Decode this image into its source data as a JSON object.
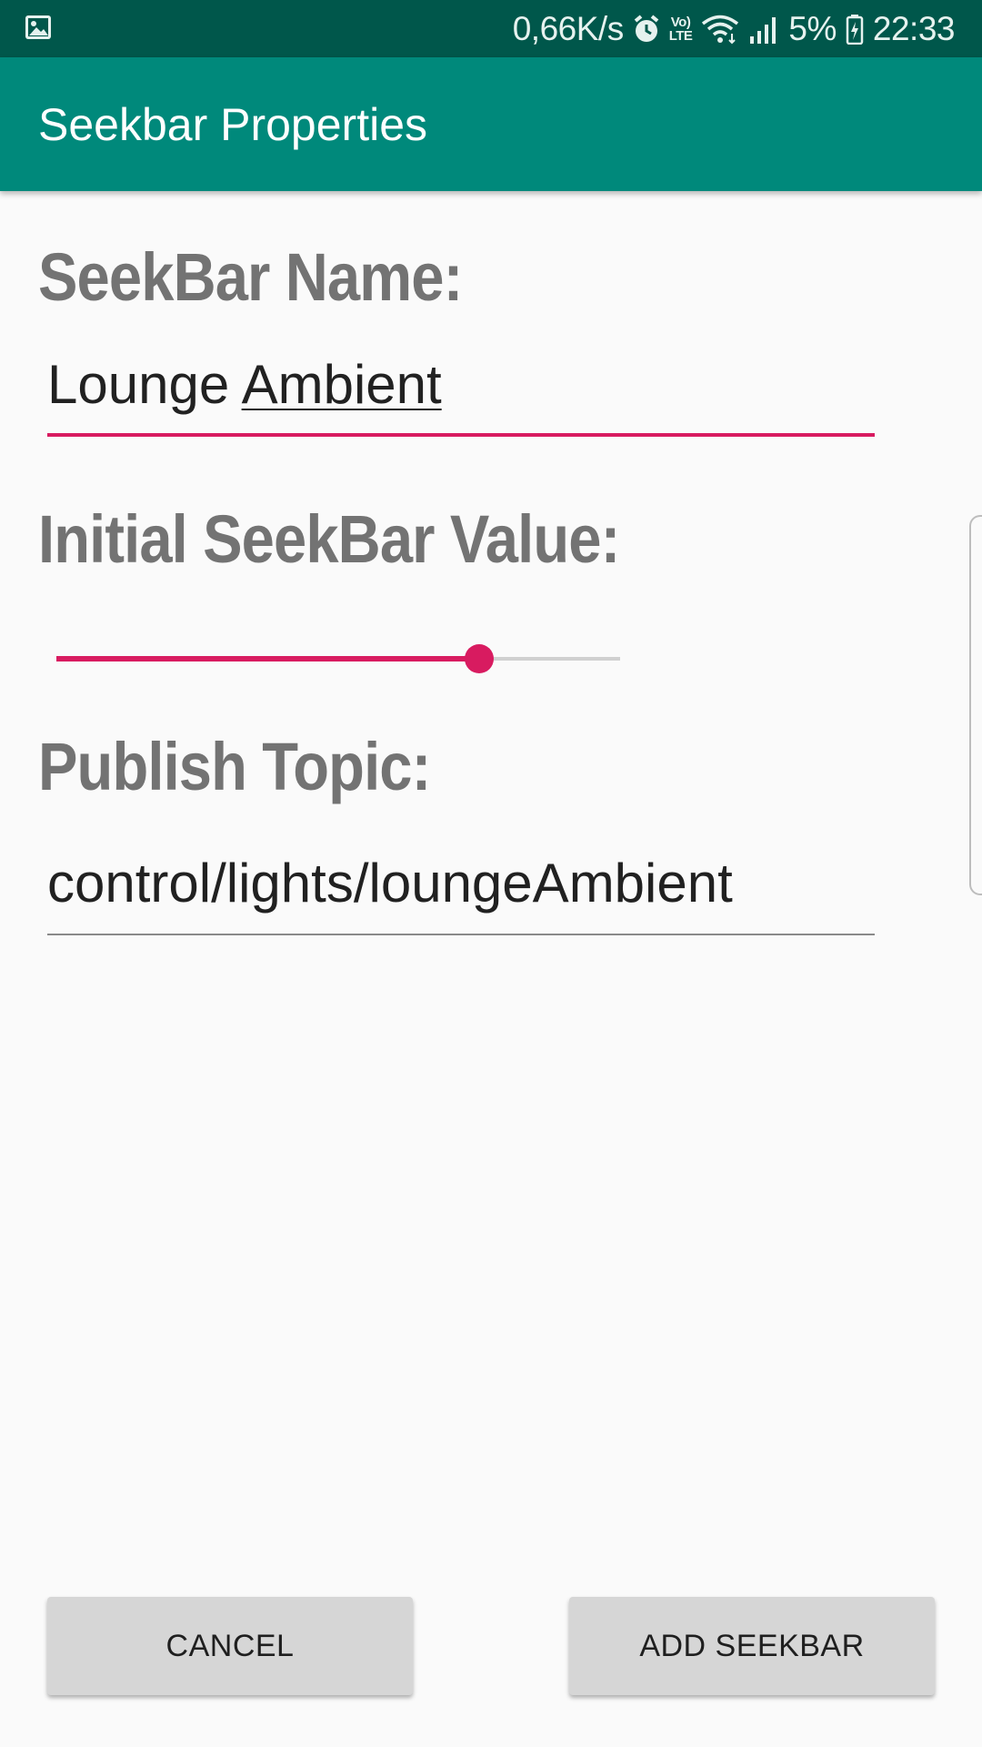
{
  "status_bar": {
    "net_speed": "0,66K/s",
    "volte_top": "Vo)",
    "volte_bottom": "LTE",
    "battery": "5%",
    "time": "22:33",
    "icons": [
      "image-notification-icon",
      "alarm-icon",
      "volte-icon",
      "wifi-icon",
      "signal-icon",
      "battery-icon"
    ]
  },
  "app_bar": {
    "title": "Seekbar Properties"
  },
  "form": {
    "name_label": "SeekBar Name:",
    "name_value_part1": "Lounge ",
    "name_value_part2": "Ambient",
    "initial_value_label": "Initial SeekBar Value:",
    "seekbar_fraction": 0.75,
    "topic_label": "Publish Topic:",
    "topic_value": "control/lights/loungeAmbient"
  },
  "buttons": {
    "cancel_label": "CANCEL",
    "add_label": "ADD SEEKBAR"
  },
  "colors": {
    "status_bar": "#00574b",
    "app_bar": "#00897b",
    "accent": "#d81b60",
    "label_text": "#737373",
    "button_bg": "#d6d6d6"
  }
}
